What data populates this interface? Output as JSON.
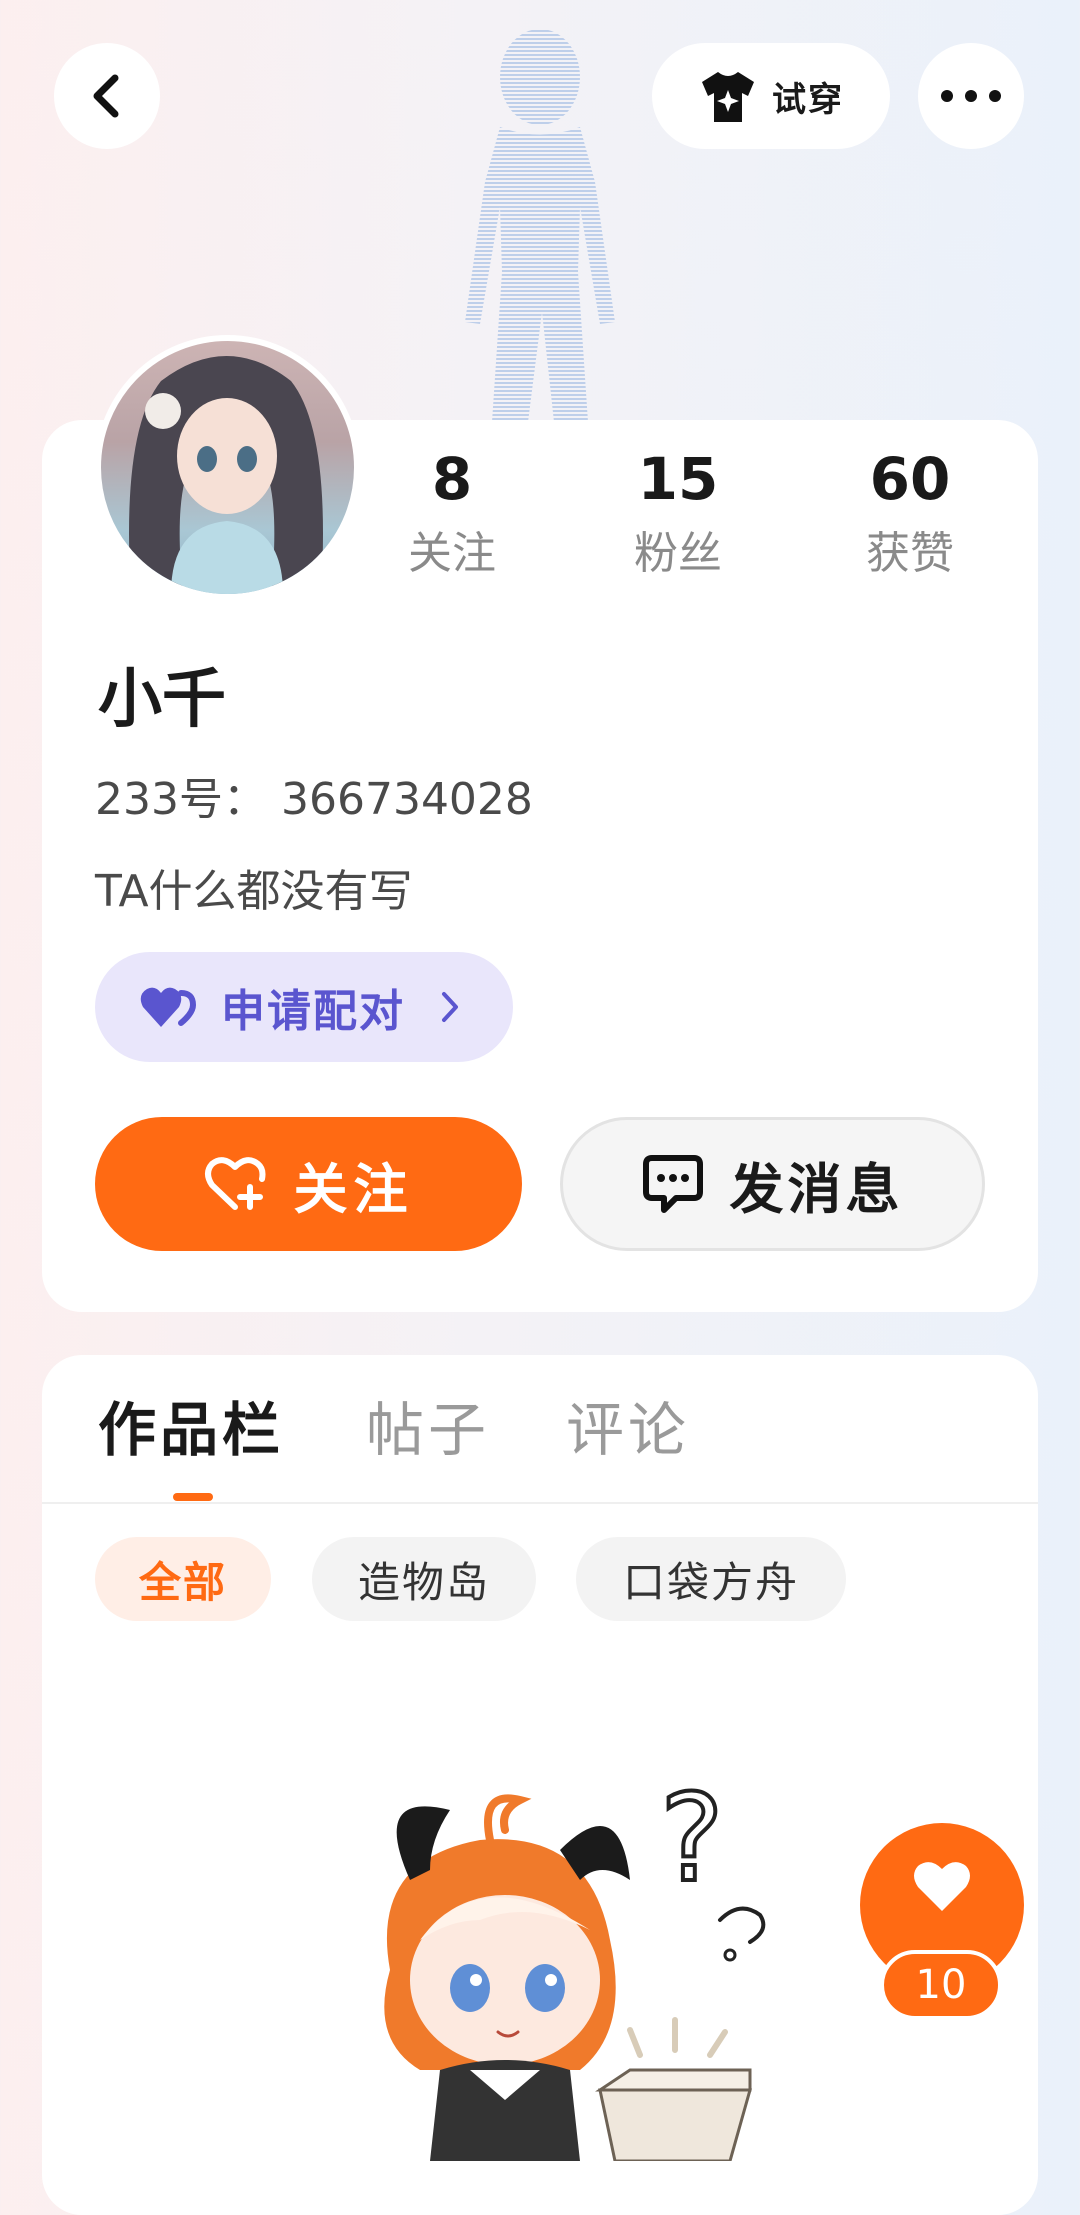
{
  "header": {
    "back_icon": "chevron-left-icon",
    "try_on_label": "试穿",
    "try_on_icon": "tshirt-sparkle-icon",
    "more_icon": "more-dots-icon"
  },
  "profile": {
    "stats": [
      {
        "value": "8",
        "label": "关注"
      },
      {
        "value": "15",
        "label": "粉丝"
      },
      {
        "value": "60",
        "label": "获赞"
      }
    ],
    "name": "小千",
    "id_line": "233号： 366734028",
    "bio": "TA什么都没有写",
    "pair_label": "申请配对",
    "follow_label": "关注",
    "message_label": "发消息"
  },
  "content": {
    "tabs": [
      "作品栏",
      "帖子",
      "评论"
    ],
    "filters": [
      "全部",
      "造物岛",
      "口袋方舟"
    ],
    "empty_state_icon": "confused-mascot-illustration"
  },
  "floating": {
    "like_icon": "heart-icon",
    "like_count": "10"
  },
  "colors": {
    "accent": "#ff6a13",
    "pair_bg": "#e9e6fb",
    "pair_text": "#5a55cf"
  }
}
